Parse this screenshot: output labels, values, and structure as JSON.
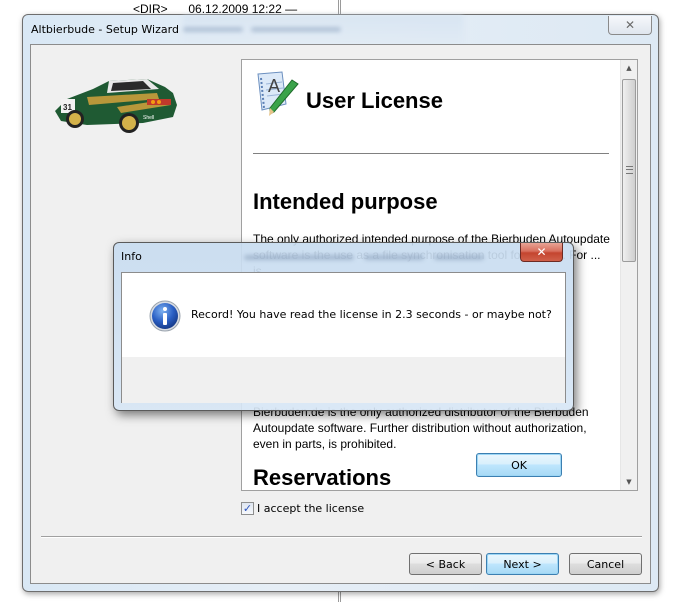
{
  "background": {
    "file_type": "<DIR>",
    "file_date": "06.12.2009 12:22 —"
  },
  "wizard": {
    "title": "Altbierbude - Setup Wizard",
    "close_icon": "close-icon",
    "license": {
      "title": "User License",
      "icon": "document-pencil-icon",
      "sections": [
        {
          "heading": "Intended purpose",
          "text": "The only authorized intended purpose of the Bierbuden Autoupdate software is the use as a file synchronisation tool for local ... For ... is"
        },
        {
          "heading": "",
          "text_italic": "Bierbuden",
          "text": "Bierbuden.de is the only authorized distributor of the Bierbuden Autoupdate software. Further distribution without authorization, even in parts, is prohibited."
        },
        {
          "heading": "Reservations",
          "text": ""
        }
      ],
      "scroll_position": 0.0
    },
    "accept_checkbox": {
      "label": "I accept the license",
      "checked": true
    },
    "buttons": {
      "back": "< Back",
      "next": "Next >",
      "cancel": "Cancel"
    }
  },
  "info_dialog": {
    "title": "Info",
    "icon": "info-icon",
    "message": "Record! You have read the license in 2.3 seconds - or maybe not?",
    "ok_label": "OK"
  }
}
